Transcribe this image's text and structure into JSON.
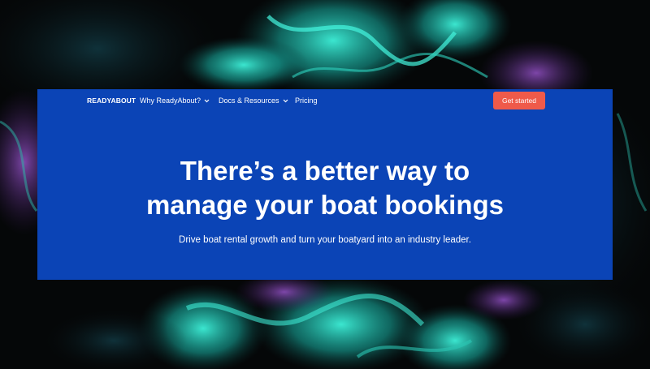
{
  "theme": {
    "card_bg": "#0b44b6",
    "accent_button": "#ef5a4a",
    "text": "#ffffff",
    "page_bg": "#050708",
    "art_teal": "#26d9c4",
    "art_purple": "#7a3fa8"
  },
  "nav": {
    "brand": "READYABOUT",
    "items": [
      {
        "label": "Why ReadyAbout?",
        "icon": "chevron-down-icon"
      },
      {
        "label": "Docs & Resources",
        "icon": "chevron-down-icon"
      },
      {
        "label": "Pricing"
      }
    ],
    "cta_label": "Get started"
  },
  "hero": {
    "title_line1": "There’s a better way to",
    "title_line2": "manage your boat bookings",
    "subtitle": "Drive boat rental growth and turn your boatyard into an industry leader."
  }
}
